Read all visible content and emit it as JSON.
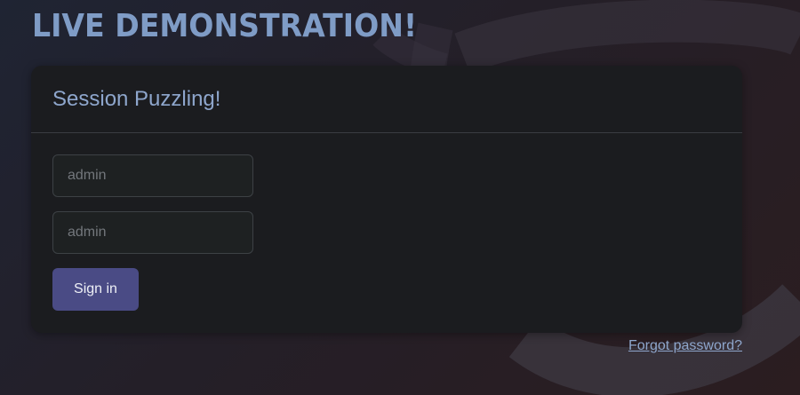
{
  "page": {
    "title": "LIVE DEMONSTRATION!"
  },
  "login_card": {
    "title": "Session Puzzling!",
    "username_placeholder": "admin",
    "password_placeholder": "admin",
    "signin_label": "Sign in"
  },
  "links": {
    "forgot_password": "Forgot password?"
  },
  "colors": {
    "title": "#7f9cc6",
    "card_background": "#1b1c1f",
    "card_title": "#8ea6cc",
    "button": "#4a4b85",
    "link": "#8ea6cc"
  }
}
